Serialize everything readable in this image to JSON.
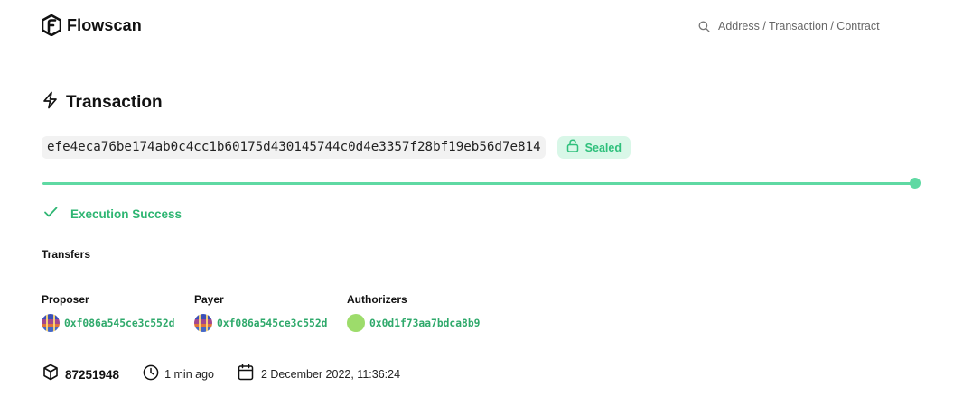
{
  "header": {
    "brand": "Flowscan",
    "search_placeholder": "Address / Transaction / Contract"
  },
  "page": {
    "title": "Transaction",
    "tx_hash": "efe4eca76be174ab0c4cc1b60175d430145744c0d4e3357f28bf19eb56d7e814",
    "status_badge": "Sealed",
    "progress_fraction": 1.0,
    "execution_status": "Execution Success",
    "transfers_label": "Transfers"
  },
  "parties": {
    "proposer": {
      "label": "Proposer",
      "address": "0xf086a545ce3c552d"
    },
    "payer": {
      "label": "Payer",
      "address": "0xf086a545ce3c552d"
    },
    "authorizers": {
      "label": "Authorizers",
      "address": "0x0d1f73aa7bdca8b9"
    }
  },
  "meta": {
    "block_height": "87251948",
    "time_ago": "1 min ago",
    "timestamp": "2 December 2022, 11:36:24"
  },
  "icons": {
    "logo": "flowscan-logo-icon",
    "search": "search-icon",
    "title": "lightning-icon",
    "badge": "lock-icon",
    "status": "checkmark-icon",
    "block": "cube-icon",
    "time": "clock-icon",
    "date": "calendar-icon"
  },
  "colors": {
    "accent_green": "#2fb673",
    "progress_green": "#5fd9a3",
    "badge_bg": "#d9f7e8",
    "address_green": "#2fa96b"
  }
}
